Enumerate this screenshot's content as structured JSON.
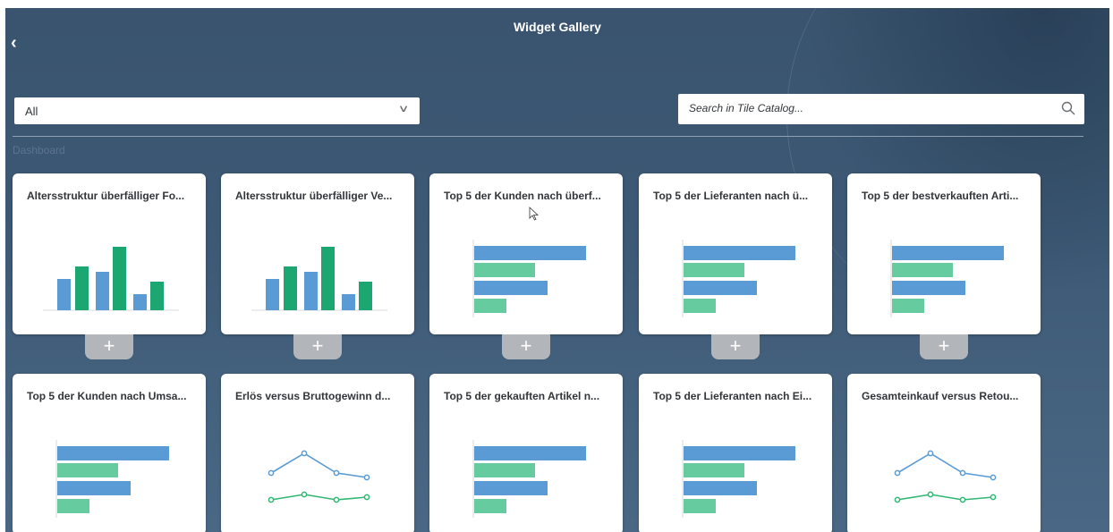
{
  "header": {
    "title": "Widget Gallery",
    "back_icon": "chevron-left-icon"
  },
  "filter": {
    "selected": "All",
    "icon": "chevron-down-icon"
  },
  "search": {
    "placeholder": "Search in Tile Catalog...",
    "value": "",
    "icon": "search-icon"
  },
  "section": {
    "label": "Dashboard"
  },
  "add_label": "+",
  "colors": {
    "blue": "#5b9bd5",
    "green": "#1ba672",
    "light_green": "#66cca0",
    "line_blue": "#5b9bd5",
    "line_green": "#2eb872"
  },
  "tiles": [
    {
      "title": "Altersstruktur überfälliger Fo...",
      "chart": "column"
    },
    {
      "title": "Altersstruktur überfälliger Ve...",
      "chart": "column"
    },
    {
      "title": "Top 5 der Kunden nach überf...",
      "chart": "bar"
    },
    {
      "title": "Top 5 der Lieferanten nach ü...",
      "chart": "bar"
    },
    {
      "title": "Top 5 der bestverkauften Arti...",
      "chart": "bar"
    },
    {
      "title": "Top 5 der Kunden nach Umsa...",
      "chart": "bar"
    },
    {
      "title": "Erlös versus Bruttogewinn d...",
      "chart": "line"
    },
    {
      "title": "Top 5 der gekauften Artikel n...",
      "chart": "bar"
    },
    {
      "title": "Top 5 der Lieferanten nach Ei...",
      "chart": "bar"
    },
    {
      "title": "Gesamteinkauf versus Retou...",
      "chart": "line"
    }
  ]
}
